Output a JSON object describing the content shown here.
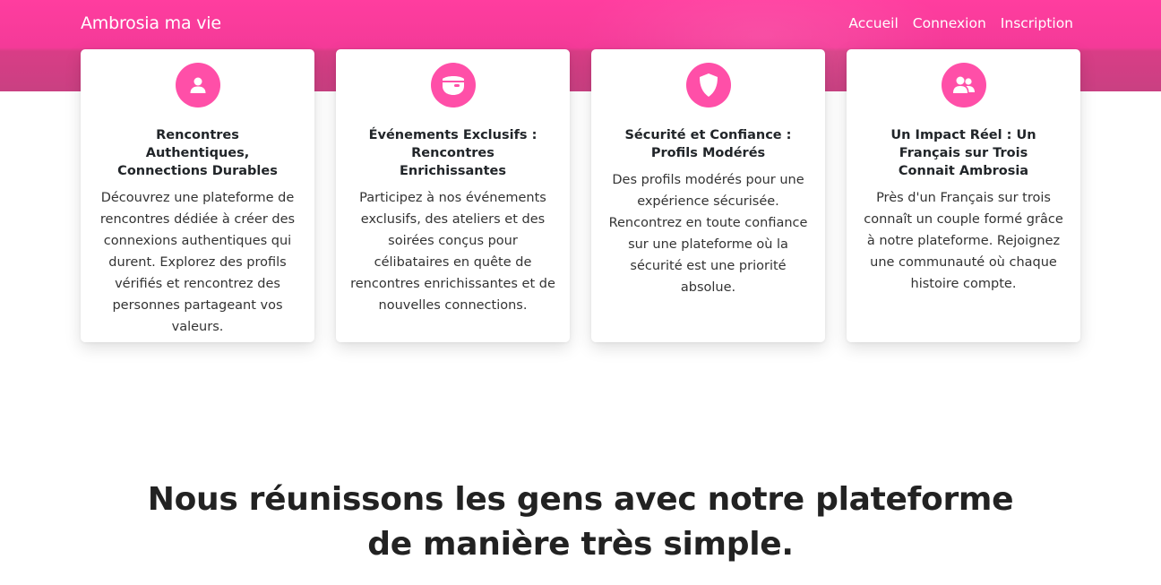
{
  "navbar": {
    "brand": "Ambrosia ma vie",
    "links": [
      "Accueil",
      "Connexion",
      "Inscription"
    ]
  },
  "colors": {
    "primary": "#ff3d9f",
    "icon_bg": "#ff4fa8"
  },
  "features": [
    {
      "icon": "user-icon",
      "title": "Rencontres Authentiques, Connections Durables",
      "text": "Découvrez une plateforme de rencontres dédiée à créer des connexions authentiques qui durent. Explorez des profils vérifiés et rencontrez des personnes partageant vos valeurs."
    },
    {
      "icon": "mask-icon",
      "title": "Événements Exclusifs : Rencontres Enrichissantes",
      "text": "Participez à nos événements exclusifs, des ateliers et des soirées conçus pour célibataires en quête de rencontres enrichissantes et de nouvelles connections."
    },
    {
      "icon": "shield-icon",
      "title": "Sécurité et Confiance : Profils Modérés",
      "text": "Des profils modérés pour une expérience sécurisée. Rencontrez en toute confiance sur une plateforme où la sécurité est une priorité absolue."
    },
    {
      "icon": "users-icon",
      "title": "Un Impact Réel : Un Français sur Trois Connait Ambrosia",
      "text": "Près d'un Français sur trois connaît un couple formé grâce à notre plateforme. Rejoignez une communauté où chaque histoire compte."
    }
  ],
  "headline": "Nous réunissons les gens avec notre plateforme de manière très simple."
}
